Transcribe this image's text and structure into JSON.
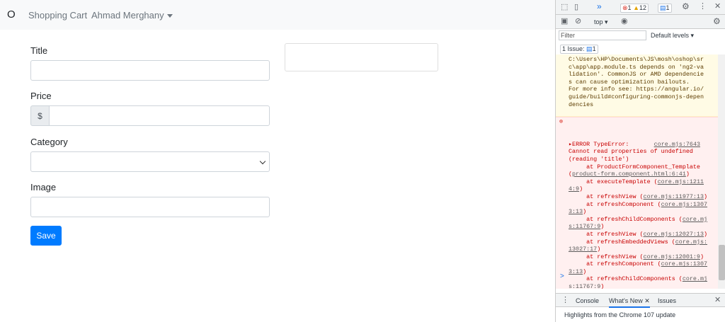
{
  "navbar": {
    "brand": "O",
    "cart_link": "Shopping Cart",
    "user_menu": "Ahmad Merghany"
  },
  "form": {
    "title_label": "Title",
    "title_value": "",
    "price_label": "Price",
    "price_prefix": "$",
    "price_value": "",
    "category_label": "Category",
    "category_selected": "",
    "image_label": "Image",
    "image_value": "",
    "save_label": "Save"
  },
  "devtools": {
    "more_tabs": "»",
    "error_count": "1",
    "warning_count": "12",
    "issue_count": "1",
    "context": "top",
    "filter_placeholder": "Filter",
    "levels": "Default levels",
    "issues_label": "1 Issue:",
    "issues_count": "1",
    "warning_text": "C:\\Users\\HP\\Documents\\JS\\mosh\\oshop\\src\\app\\app.module.ts depends on 'ng2-validation'. CommonJS or AMD dependencies can cause optimization bailouts.\nFor more info see: https://angular.io/guide/build#configuring-commonjs-dependencies",
    "error_lines": [
      "ERROR TypeError:",
      "core.mjs:7643",
      "Cannot read properties of undefined",
      "(reading 'title')",
      "at ProductFormComponent_Template",
      "product-form.component.html:6:41",
      "at executeTemplate",
      "core.mjs:1211",
      "4:9",
      "at refreshView",
      "core.mjs:11977:13",
      "at refreshComponent",
      "core.mjs:1307",
      "3:13",
      "at refreshChildComponents",
      "core.mj",
      "s:11767:9",
      "at refreshView",
      "core.mjs:12027:13",
      "at refreshEmbeddedViews",
      "core.mjs:",
      "13027:17",
      "at refreshView",
      "core.mjs:12001:9",
      "at refreshComponent",
      "core.mjs:1307",
      "3:13",
      "at refreshChildComponents",
      "core.mj",
      "s:11767:9"
    ],
    "prompt": ">",
    "drawer_tabs": [
      "Console",
      "What's New",
      "Issues"
    ],
    "drawer_text": "Highlights from the Chrome 107 update"
  },
  "colors": {
    "primary": "#007bff",
    "navbar_bg": "#f8f9fa",
    "error_text": "#c80000",
    "warning_bg": "#fffbe5",
    "error_bg": "#fff0f0"
  }
}
